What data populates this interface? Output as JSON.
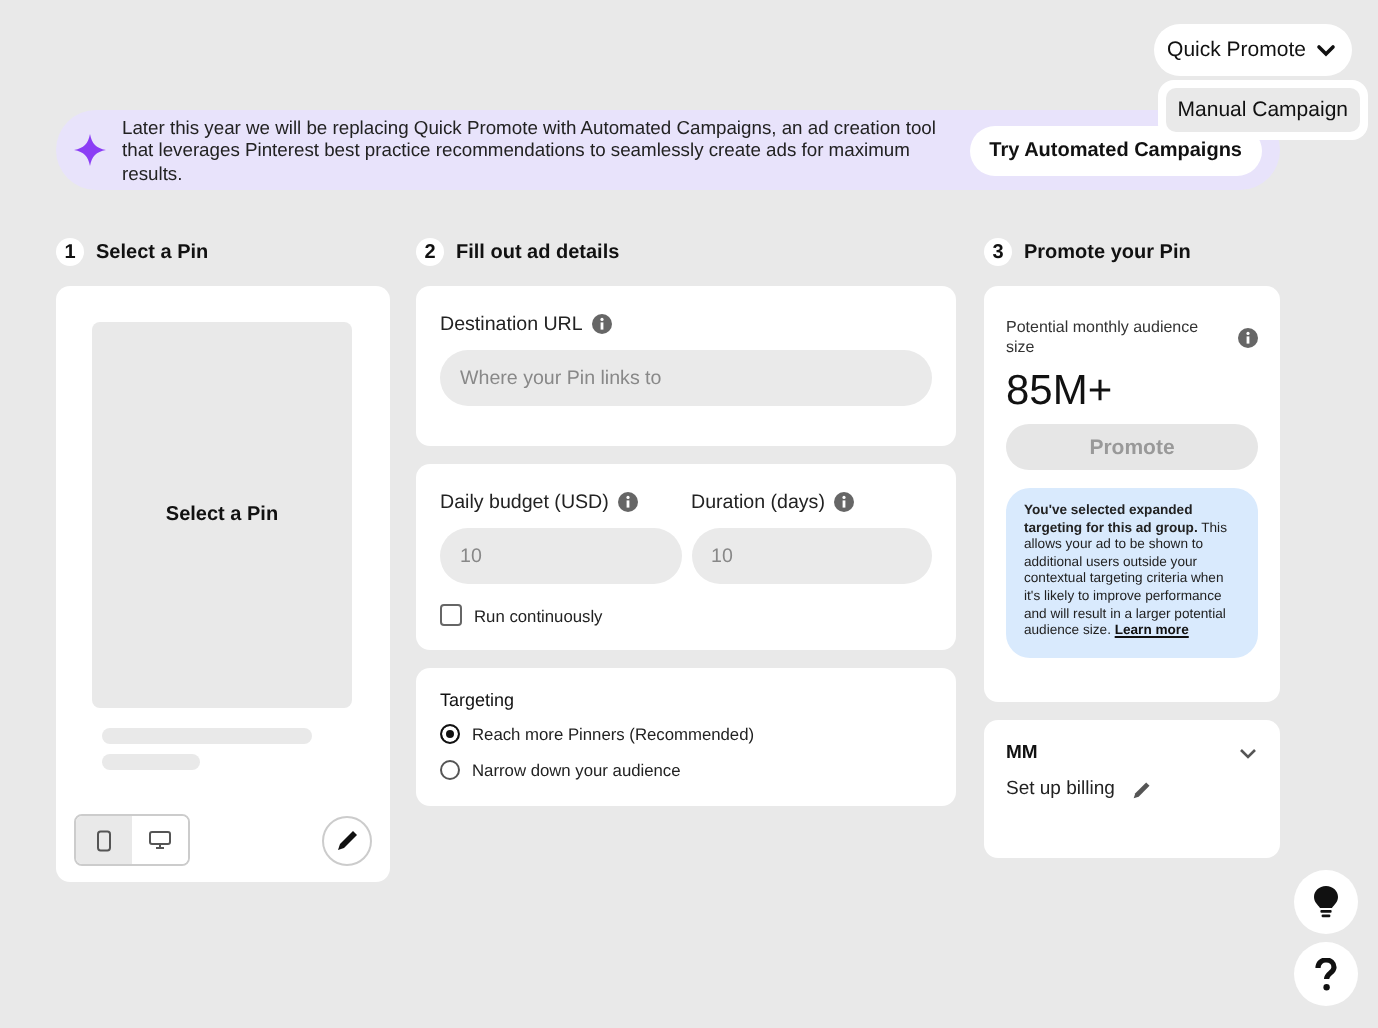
{
  "header": {
    "mode_button": {
      "label": "Quick Promote",
      "expanded": true
    },
    "menu": [
      {
        "label": "Manual Campaign",
        "selected": true
      }
    ]
  },
  "banner": {
    "text": "Later this year we will be replacing Quick Promote with Automated Campaigns, an ad creation tool that leverages Pinterest best practice recommendations to seamlessly create ads for maximum results.",
    "button": "Try Automated Campaigns"
  },
  "steps": [
    {
      "number": "1",
      "title": "Select a Pin"
    },
    {
      "number": "2",
      "title": "Fill out ad details"
    },
    {
      "number": "3",
      "title": "Promote your Pin"
    }
  ],
  "pin_panel": {
    "placeholder": "Select a Pin",
    "device_toggle": [
      {
        "kind": "mobile",
        "selected": true
      },
      {
        "kind": "desktop",
        "selected": false
      }
    ]
  },
  "details": {
    "destination": {
      "label": "Destination URL",
      "placeholder": "Where your Pin links to"
    },
    "budget": {
      "label": "Daily budget (USD)",
      "placeholder": "10"
    },
    "duration": {
      "label": "Duration (days)",
      "placeholder": "10"
    },
    "run_continuously": {
      "label": "Run continuously",
      "checked": false
    },
    "targeting": {
      "title": "Targeting",
      "options": [
        {
          "label": "Reach more Pinners (Recommended)",
          "selected": true
        },
        {
          "label": "Narrow down your audience",
          "selected": false
        }
      ]
    }
  },
  "promote": {
    "audience_label": "Potential monthly audience size",
    "audience_value": "85M+",
    "button": {
      "label": "Promote",
      "disabled": true
    },
    "notice": "**You've selected expanded targeting for this ad group.** This allows your ad to be shown to additional users outside your contextual targeting criteria when it's likely to improve performance and will result in a larger potential audience size.",
    "notice_link": "Learn more"
  },
  "billing": {
    "account": "MM",
    "expanded": false,
    "action": "Set up billing"
  }
}
